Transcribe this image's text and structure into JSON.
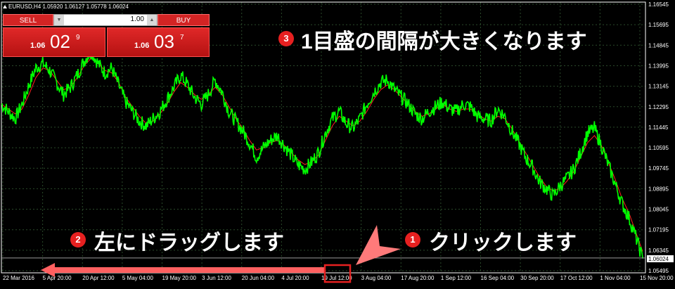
{
  "header": {
    "title": "EURUSD,H4  1.05920 1.06127 1.05778 1.06024"
  },
  "trade_panel": {
    "sell_label": "SELL",
    "buy_label": "BUY",
    "lot_value": "1.00",
    "sell_price": {
      "prefix": "1.06",
      "big": "02",
      "sup": "9"
    },
    "buy_price": {
      "prefix": "1.06",
      "big": "03",
      "sup": "7"
    }
  },
  "price_axis": {
    "ticks": [
      "1.16545",
      "1.15695",
      "1.14845",
      "1.13995",
      "1.13145",
      "1.12295",
      "1.11445",
      "1.10595",
      "1.09745",
      "1.08895",
      "1.08045",
      "1.07195",
      "1.06345",
      "1.05495"
    ],
    "current": "1.06024"
  },
  "time_axis": {
    "ticks": [
      "22 Mar 2016",
      "5 Apr 20:00",
      "20 Apr 12:00",
      "5 May 04:00",
      "19 May 20:00",
      "3 Jun 12:00",
      "20 Jun 04:00",
      "4 Jul 20:00",
      "19 Jul 12:00",
      "3 Aug 04:00",
      "17 Aug 20:00",
      "1 Sep 12:00",
      "16 Sep 04:00",
      "30 Sep 20:00",
      "17 Oct 12:00",
      "1 Nov 04:00",
      "15 Nov 20:00"
    ]
  },
  "annotations": {
    "step1": {
      "num": "1",
      "text": "クリックします"
    },
    "step2": {
      "num": "2",
      "text": "左にドラッグします"
    },
    "step3": {
      "num": "3",
      "text": "1目盛の間隔が大きくなります"
    }
  },
  "chart_data": {
    "type": "line",
    "series": [],
    "y_ticks": [
      1.16545,
      1.15695,
      1.14845,
      1.13995,
      1.13145,
      1.12295,
      1.11445,
      1.10595,
      1.09745,
      1.08895,
      1.08045,
      1.07195,
      1.06345,
      1.05495
    ],
    "ylim": [
      1.05495,
      1.16545
    ],
    "x_ticks": [
      "22 Mar 2016",
      "5 Apr 20:00",
      "20 Apr 12:00",
      "5 May 04:00",
      "19 May 20:00",
      "3 Jun 12:00",
      "20 Jun 04:00",
      "4 Jul 20:00",
      "19 Jul 12:00",
      "3 Aug 04:00",
      "17 Aug 20:00",
      "1 Sep 12:00",
      "16 Sep 04:00",
      "30 Sep 20:00",
      "17 Oct 12:00",
      "1 Nov 04:00",
      "15 Nov 20:00"
    ],
    "price_path": [
      1.124,
      1.121,
      1.118,
      1.124,
      1.132,
      1.139,
      1.141,
      1.138,
      1.133,
      1.128,
      1.131,
      1.136,
      1.142,
      1.146,
      1.141,
      1.137,
      1.139,
      1.132,
      1.125,
      1.121,
      1.117,
      1.115,
      1.118,
      1.121,
      1.126,
      1.131,
      1.136,
      1.132,
      1.127,
      1.124,
      1.128,
      1.134,
      1.129,
      1.121,
      1.117,
      1.113,
      1.108,
      1.102,
      1.106,
      1.109,
      1.111,
      1.107,
      1.103,
      1.099,
      1.097,
      1.1,
      1.104,
      1.112,
      1.118,
      1.121,
      1.116,
      1.114,
      1.118,
      1.124,
      1.129,
      1.133,
      1.134,
      1.13,
      1.127,
      1.124,
      1.12,
      1.118,
      1.121,
      1.123,
      1.125,
      1.122,
      1.121,
      1.124,
      1.123,
      1.119,
      1.118,
      1.117,
      1.122,
      1.119,
      1.113,
      1.108,
      1.102,
      1.098,
      1.092,
      1.089,
      1.086,
      1.09,
      1.093,
      1.097,
      1.104,
      1.112,
      1.114,
      1.107,
      1.099,
      1.091,
      1.083,
      1.077,
      1.069,
      1.06
    ],
    "ma_path": [
      1.124,
      1.122,
      1.12,
      1.122,
      1.128,
      1.135,
      1.139,
      1.138,
      1.134,
      1.13,
      1.131,
      1.135,
      1.14,
      1.143,
      1.141,
      1.138,
      1.137,
      1.133,
      1.127,
      1.123,
      1.119,
      1.116,
      1.117,
      1.12,
      1.124,
      1.129,
      1.133,
      1.131,
      1.128,
      1.126,
      1.128,
      1.131,
      1.128,
      1.123,
      1.118,
      1.114,
      1.109,
      1.105,
      1.106,
      1.108,
      1.109,
      1.107,
      1.104,
      1.101,
      1.099,
      1.1,
      1.103,
      1.109,
      1.115,
      1.119,
      1.117,
      1.115,
      1.117,
      1.121,
      1.126,
      1.13,
      1.132,
      1.13,
      1.127,
      1.124,
      1.121,
      1.119,
      1.12,
      1.122,
      1.124,
      1.122,
      1.121,
      1.122,
      1.122,
      1.12,
      1.118,
      1.117,
      1.119,
      1.118,
      1.114,
      1.109,
      1.104,
      1.099,
      1.094,
      1.09,
      1.088,
      1.089,
      1.092,
      1.096,
      1.102,
      1.108,
      1.111,
      1.107,
      1.1,
      1.093,
      1.085,
      1.079,
      1.071,
      1.063
    ],
    "colors": {
      "price": "#00ff00",
      "ma": "#ff2020",
      "grid": "#2a4a2a",
      "current_line": "#9a9a9a",
      "annotation": "#e62020",
      "arrow": "#ff6060"
    }
  }
}
